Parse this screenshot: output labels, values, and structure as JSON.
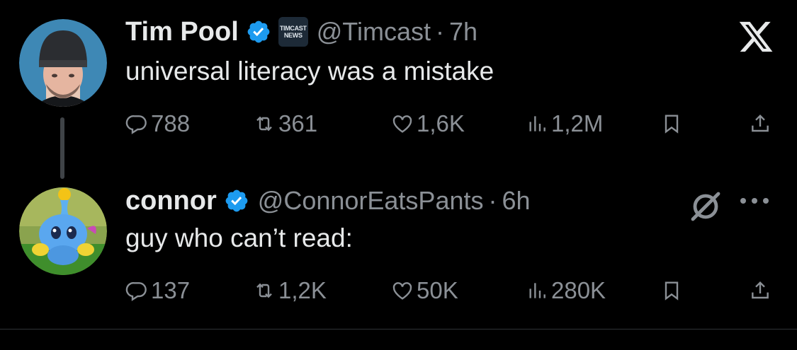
{
  "tweets": [
    {
      "author": "Tim Pool",
      "badge_text": [
        "TIMCAST",
        "NEWS"
      ],
      "handle": "@Timcast",
      "time": "7h",
      "text": "universal literacy was a mistake",
      "replies": "788",
      "reposts": "361",
      "likes": "1,6K",
      "views": "1,2M"
    },
    {
      "author": "connor",
      "handle": "@ConnorEatsPants",
      "time": "6h",
      "text": "guy who can’t read:",
      "replies": "137",
      "reposts": "1,2K",
      "likes": "50K",
      "views": "280K"
    }
  ],
  "separator": "·",
  "colors": {
    "background": "#000000",
    "text": "#e7e9ea",
    "secondary": "#8b9096",
    "verified": "#1d9bf0"
  },
  "icons": [
    "verified-icon",
    "x-logo-icon",
    "reply-icon",
    "repost-icon",
    "like-icon",
    "views-icon",
    "bookmark-icon",
    "share-icon",
    "grok-icon",
    "more-icon"
  ]
}
